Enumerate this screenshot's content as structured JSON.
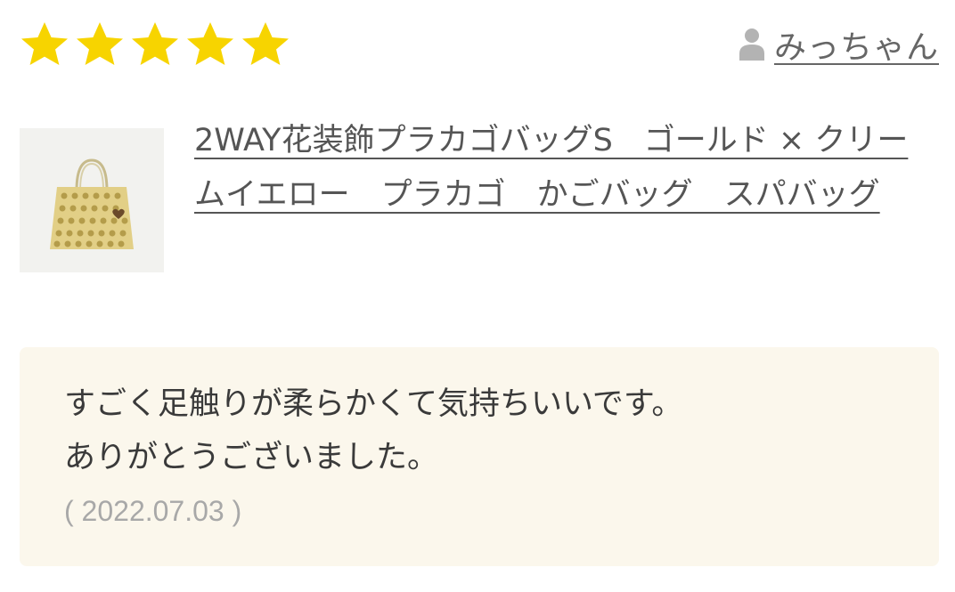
{
  "rating": {
    "value": 5,
    "max": 5,
    "star_color": "#f7d400",
    "star_icon": "star-icon"
  },
  "reviewer": {
    "icon": "user-icon",
    "name": "みっちゃん"
  },
  "product": {
    "thumbnail_icon": "basket-bag-thumbnail",
    "name": "2WAY花装飾プラカゴバッグS　ゴールド × クリームイエロー　プラカゴ　かごバッグ　スパバッグ"
  },
  "comment": {
    "lines": [
      "すごく足触りが柔らかくて気持ちいいです。",
      "ありがとうございました。"
    ],
    "date": "( 2022.07.03 )"
  }
}
